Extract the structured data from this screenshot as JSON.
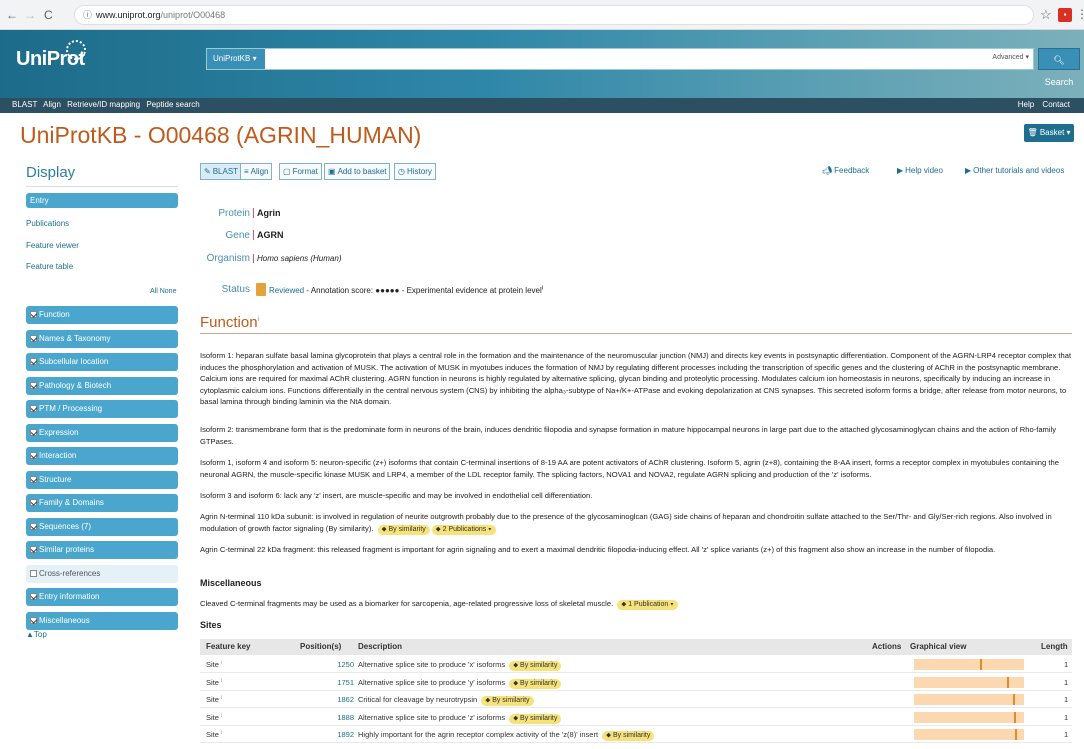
{
  "browser": {
    "back": "←",
    "forward": "→",
    "reload": "C",
    "url_domain": "www.uniprot.org",
    "url_path": "/uniprot/O00468"
  },
  "header": {
    "logo": "UniProt",
    "db_select": "UniProtKB ▾",
    "advanced": "Advanced ▾",
    "search_button": "Search",
    "nav_links": [
      "BLAST",
      "Align",
      "Retrieve/ID mapping",
      "Peptide search"
    ],
    "right_links": [
      "Help",
      "Contact"
    ]
  },
  "page": {
    "title": "UniProtKB - O00468 (AGRIN_HUMAN)",
    "basket": "Basket ▾"
  },
  "sidebar": {
    "title": "Display",
    "entry": "Entry",
    "links": [
      "Publications",
      "Feature viewer",
      "Feature table"
    ],
    "all_none": "All None",
    "sections": [
      {
        "label": "Function",
        "checked": true
      },
      {
        "label": "Names & Taxonomy",
        "checked": true
      },
      {
        "label": "Subcellular location",
        "checked": true
      },
      {
        "label": "Pathology & Biotech",
        "checked": true
      },
      {
        "label": "PTM / Processing",
        "checked": true
      },
      {
        "label": "Expression",
        "checked": true
      },
      {
        "label": "Interaction",
        "checked": true
      },
      {
        "label": "Structure",
        "checked": true
      },
      {
        "label": "Family & Domains",
        "checked": true
      },
      {
        "label": "Sequences (7)",
        "checked": true
      },
      {
        "label": "Similar proteins",
        "checked": true
      },
      {
        "label": "Cross-references",
        "checked": false
      },
      {
        "label": "Entry information",
        "checked": true
      },
      {
        "label": "Miscellaneous",
        "checked": true
      }
    ],
    "top": "▲Top"
  },
  "toolbar": {
    "buttons": [
      "BLAST",
      "Align",
      "Format",
      "Add to basket",
      "History"
    ],
    "feedback": "Feedback",
    "help_video": "Help video",
    "tutorials": "Other tutorials and videos"
  },
  "entry": {
    "protein_label": "Protein",
    "protein": "Agrin",
    "gene_label": "Gene",
    "gene": "AGRN",
    "organism_label": "Organism",
    "organism": "Homo sapiens (Human)",
    "status_label": "Status",
    "status_reviewed": "Reviewed",
    "status_text": "- Annotation score: ●●●●● - Experimental evidence at protein level",
    "status_sup": "i"
  },
  "function": {
    "title": "Function",
    "title_sup": "i",
    "p1": "Isoform 1: heparan sulfate basal lamina glycoprotein that plays a central role in the formation and the maintenance of the neuromuscular junction (NMJ) and directs key events in postsynaptic differentiation. Component of the AGRN-LRP4 receptor complex that induces the phosphorylation and activation of MUSK. The activation of MUSK in myotubes induces the formation of NMJ by regulating different processes including the transcription of specific genes and the clustering of AChR in the postsynaptic membrane. Calcium ions are required for maximal AChR clustering. AGRN function in neurons is highly regulated by alternative splicing, glycan binding and proteolytic processing. Modulates calcium ion homeostasis in neurons, specifically by inducing an increase in cytoplasmic calcium ions. Functions differentially in the central nervous system (CNS) by inhibiting the alpha₃-subtype of Na+/K+-ATPase and evoking depolarization at CNS synapses. This secreted isoform forms a bridge, after release from motor neurons, to basal lamina through binding laminin via the NtA domain.",
    "p2": "Isoform 2: transmembrane form that is the predominate form in neurons of the brain, induces dendritic filopodia and synapse formation in mature hippocampal neurons in large part due to the attached glycosaminoglycan chains and the action of Rho-family GTPases.",
    "p3": "Isoform 1, isoform 4 and isoform 5: neuron-specific (z+) isoforms that contain C-terminal insertions of 8-19 AA are potent activators of AChR clustering. Isoform 5, agrin (z+8), containing the 8-AA insert, forms a receptor complex in myotubules containing the neuronal AGRN, the muscle-specific kinase MUSK and LRP4, a member of the LDL receptor family. The splicing factors, NOVA1 and NOVA2, regulate AGRN splicing and production of the 'z' isoforms.",
    "p4": "Isoform 3 and isoform 6: lack any 'z' insert, are muscle-specific and may be involved in endothelial cell differentiation.",
    "p5": "Agrin N-terminal 110 kDa subunit: is involved in regulation of neurite outgrowth probably due to the presence of the glycosaminoglcan (GAG) side chains of heparan and chondroitin sulfate attached to the Ser/Thr- and Gly/Ser-rich regions. Also involved in modulation of growth factor signaling (By similarity).",
    "p5_pill1": "By similarity",
    "p5_pill2": "2 Publications ▾",
    "p6": "Agrin C-terminal 22 kDa fragment: this released fragment is important for agrin signaling and to exert a maximal dendritic filopodia-inducing effect. All 'z' splice variants (z+) of this fragment also show an increase in the number of filopodia.",
    "misc_title": "Miscellaneous",
    "misc_text": "Cleaved C-terminal fragments may be used as a biomarker for sarcopenia, age-related progressive loss of skeletal muscle.",
    "misc_pill": "1 Publication ▾",
    "sites_title": "Sites"
  },
  "sites": {
    "headers": {
      "feature": "Feature key",
      "position": "Position(s)",
      "description": "Description",
      "actions": "Actions",
      "graphical": "Graphical view",
      "length": "Length"
    },
    "seq_length": 2068,
    "rows": [
      {
        "key": "Site",
        "pos": "1250",
        "desc": "Alternative splice site to produce 'x' isoforms",
        "pill": "By similarity",
        "length": "1",
        "pos_num": 1250
      },
      {
        "key": "Site",
        "pos": "1751",
        "desc": "Alternative splice site to produce 'y' isoforms",
        "pill": "By similarity",
        "length": "1",
        "pos_num": 1751
      },
      {
        "key": "Site",
        "pos": "1862",
        "desc": "Critical for cleavage by neurotrypsin",
        "pill": "By similarity",
        "length": "1",
        "pos_num": 1862
      },
      {
        "key": "Site",
        "pos": "1888",
        "desc": "Alternative splice site to produce 'z' isoforms",
        "pill": "By similarity",
        "length": "1",
        "pos_num": 1888
      },
      {
        "key": "Site",
        "pos": "1892",
        "desc": "Highly important for the agrin receptor complex activity of the 'z(8)' insert",
        "pill": "By similarity",
        "length": "1",
        "pos_num": 1892
      }
    ]
  },
  "colors": {
    "brand": "#2f87a8",
    "title": "#c05a1b",
    "sidebar": "#4aa6cd",
    "pill": "#f5e27a"
  }
}
